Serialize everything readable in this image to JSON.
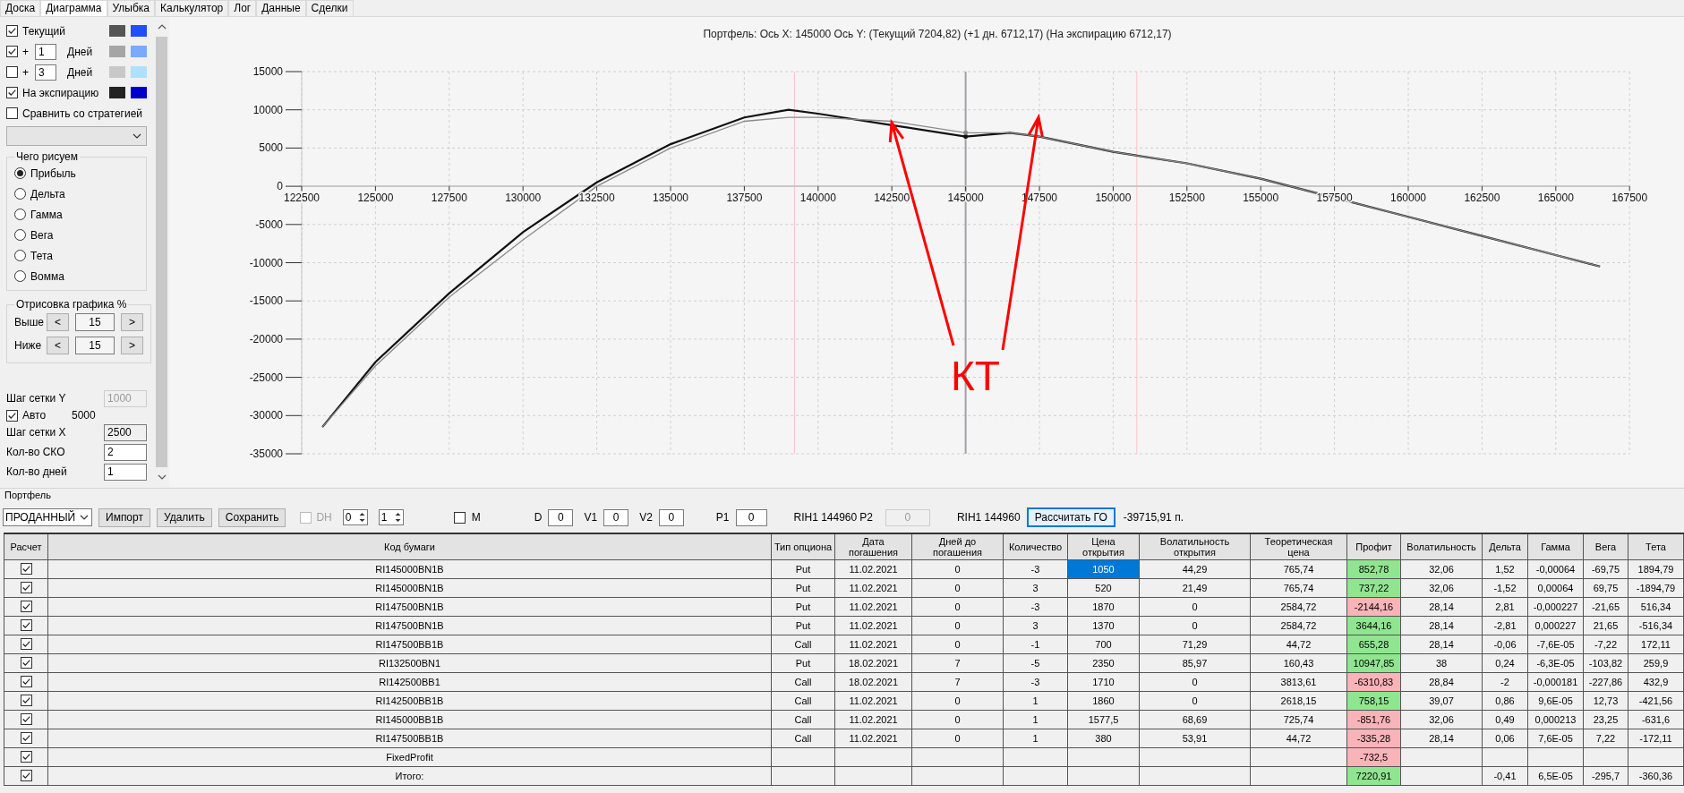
{
  "tabs": [
    {
      "label": "Доска",
      "selected": false
    },
    {
      "label": "Диаграмма",
      "selected": true
    },
    {
      "label": "Улыбка",
      "selected": false
    },
    {
      "label": "Калькулятор",
      "selected": false
    },
    {
      "label": "Лог",
      "selected": false
    },
    {
      "label": "Данные",
      "selected": false
    },
    {
      "label": "Сделки",
      "selected": false
    }
  ],
  "sidebar": {
    "series": [
      {
        "kind": "plain",
        "label": "Текущий",
        "checked": true,
        "swatches": [
          {
            "color": "#555555"
          },
          {
            "color": "#1f4fff"
          }
        ]
      },
      {
        "kind": "days",
        "checked": true,
        "plus": "+",
        "days": "1",
        "unit": "Дней",
        "swatches": [
          {
            "color": "#a5a5a5"
          },
          {
            "color": "#7aa9ff"
          }
        ]
      },
      {
        "kind": "days",
        "checked": false,
        "plus": "+",
        "days": "3",
        "unit": "Дней",
        "swatches": [
          {
            "color": "#c8c8c8"
          },
          {
            "color": "#aee0ff"
          }
        ]
      },
      {
        "kind": "plain",
        "label": "На экспирацию",
        "checked": true,
        "swatches": [
          {
            "color": "#222222"
          },
          {
            "color": "#0000cc"
          }
        ]
      }
    ],
    "compare": {
      "label": "Сравнить со стратегией",
      "checked": false
    },
    "draw_group": {
      "title": "Чего рисуем",
      "options": [
        {
          "label": "Прибыль",
          "selected": true
        },
        {
          "label": "Дельта",
          "selected": false
        },
        {
          "label": "Гамма",
          "selected": false
        },
        {
          "label": "Вега",
          "selected": false
        },
        {
          "label": "Тета",
          "selected": false
        },
        {
          "label": "Вомма",
          "selected": false
        }
      ]
    },
    "range_group": {
      "title": "Отрисовка графика %",
      "rows": [
        {
          "label": "Выше",
          "dec": "<",
          "value": "15",
          "inc": ">"
        },
        {
          "label": "Ниже",
          "dec": "<",
          "value": "15",
          "inc": ">"
        }
      ]
    },
    "grid": [
      {
        "kind": "field",
        "label": "Шаг сетки Y",
        "value": "1000",
        "disabled": true,
        "readonly": false
      },
      {
        "kind": "auto",
        "label": "Авто",
        "checked": true,
        "value": "5000"
      },
      {
        "kind": "field",
        "label": "Шаг сетки X",
        "value": "2500",
        "disabled": false,
        "readonly": true
      },
      {
        "kind": "field",
        "label": "Кол-во СКО",
        "value": "2",
        "disabled": false,
        "readonly": false
      },
      {
        "kind": "field",
        "label": "Кол-во дней",
        "value": "1",
        "disabled": false,
        "readonly": false
      }
    ]
  },
  "chart": {
    "title": "Портфель: Ось X: 145000 Ось Y:  (Текущий 7204,82)  (+1 дн. 6712,17)  (На экспирацию 6712,17)",
    "chart_data": {
      "type": "line",
      "x": [
        123200,
        125000,
        127500,
        130000,
        132500,
        135000,
        137500,
        139000,
        140000,
        142500,
        145000,
        146500,
        147500,
        150000,
        152500,
        155000,
        157500,
        160000,
        162500,
        165000,
        166500
      ],
      "series": [
        {
          "color": "#111111",
          "values": [
            -31500,
            -23000,
            -14000,
            -6000,
            500,
            5500,
            9000,
            10000,
            9500,
            8000,
            6500,
            7000,
            6500,
            4500,
            3000,
            1000,
            -1500,
            -4000,
            -6500,
            -9000,
            -10500
          ]
        },
        {
          "color": "#8a8a8a",
          "values": [
            -31500,
            -23500,
            -14500,
            -7000,
            0,
            5000,
            8500,
            9000,
            9000,
            8500,
            7000,
            7000,
            6500,
            4500,
            3000,
            1000,
            -1500,
            -4000,
            -6500,
            -9000,
            -10500
          ]
        }
      ],
      "xlim": [
        122500,
        167500
      ],
      "ylim": [
        -35000,
        15000
      ],
      "xticks": [
        122500,
        125000,
        127500,
        130000,
        132500,
        135000,
        137500,
        140000,
        142500,
        145000,
        147500,
        150000,
        152500,
        155000,
        157500,
        160000,
        162500,
        165000,
        167500
      ],
      "yticks": [
        -35000,
        -30000,
        -25000,
        -20000,
        -15000,
        -10000,
        -5000,
        0,
        5000,
        10000,
        15000
      ],
      "grid": true,
      "ref_lines": [
        {
          "axis": "x",
          "value": 139200,
          "color": "#ffc0c8"
        },
        {
          "axis": "x",
          "value": 150800,
          "color": "#ffc0c8"
        },
        {
          "axis": "x",
          "value": 145000,
          "color": "#a0a0a8"
        }
      ],
      "annotations": [
        "КТ"
      ]
    }
  },
  "portfolio": {
    "title": "Портфель",
    "filter": "ПРОДАННЫЙ",
    "buttons": [
      "Импорт",
      "Удалить",
      "Сохранить"
    ],
    "dh": {
      "label": "DH",
      "checked": false,
      "disabled": true
    },
    "spinners": [
      "0",
      "1"
    ],
    "m": {
      "label": "M",
      "checked": false
    },
    "fields": [
      {
        "label": "D",
        "value": "0",
        "disabled": false
      },
      {
        "label": "V1",
        "value": "0",
        "disabled": false
      },
      {
        "label": "V2",
        "value": "0",
        "disabled": false
      },
      {
        "label": "P1",
        "value": "0",
        "disabled": false,
        "note": "RIH1 144960"
      },
      {
        "label": "P2",
        "value": "0",
        "disabled": true,
        "note": "RIH1 144960"
      }
    ],
    "calc_button": "Рассчитать ГО",
    "margin": "-39715,91 п."
  },
  "table": {
    "columns": [
      "Расчет",
      "Код бумаги",
      "Тип опциона",
      "Дата погашения",
      "Дней до погашения",
      "Количество",
      "Цена открытия",
      "Волатильность открытия",
      "Теоретическая цена",
      "Профит",
      "Волатильность",
      "Дельта",
      "Гамма",
      "Вега",
      "Тета"
    ],
    "rows": [
      {
        "checked": true,
        "price_selected": true,
        "color": "#90e690",
        "cells": [
          "",
          "RI145000BN1B",
          "Put",
          "11.02.2021",
          "0",
          "-3",
          "1050",
          "44,29",
          "765,74",
          "852,78",
          "32,06",
          "1,52",
          "-0,00064",
          "-69,75",
          "1894,79"
        ]
      },
      {
        "checked": true,
        "price_selected": false,
        "color": "#90e690",
        "cells": [
          "",
          "RI145000BN1B",
          "Put",
          "11.02.2021",
          "0",
          "3",
          "520",
          "21,49",
          "765,74",
          "737,22",
          "32,06",
          "-1,52",
          "0,00064",
          "69,75",
          "-1894,79"
        ]
      },
      {
        "checked": true,
        "price_selected": false,
        "color": "#f8b4b8",
        "cells": [
          "",
          "RI147500BN1B",
          "Put",
          "11.02.2021",
          "0",
          "-3",
          "1870",
          "0",
          "2584,72",
          "-2144,16",
          "28,14",
          "2,81",
          "-0,000227",
          "-21,65",
          "516,34"
        ]
      },
      {
        "checked": true,
        "price_selected": false,
        "color": "#90e690",
        "cells": [
          "",
          "RI147500BN1B",
          "Put",
          "11.02.2021",
          "0",
          "3",
          "1370",
          "0",
          "2584,72",
          "3644,16",
          "28,14",
          "-2,81",
          "0,000227",
          "21,65",
          "-516,34"
        ]
      },
      {
        "checked": true,
        "price_selected": false,
        "color": "#90e690",
        "cells": [
          "",
          "RI147500BB1B",
          "Call",
          "11.02.2021",
          "0",
          "-1",
          "700",
          "71,29",
          "44,72",
          "655,28",
          "28,14",
          "-0,06",
          "-7,6E-05",
          "-7,22",
          "172,11"
        ]
      },
      {
        "checked": true,
        "price_selected": false,
        "color": "#90e690",
        "cells": [
          "",
          "RI132500BN1",
          "Put",
          "18.02.2021",
          "7",
          "-5",
          "2350",
          "85,97",
          "160,43",
          "10947,85",
          "38",
          "0,24",
          "-6,3E-05",
          "-103,82",
          "259,9"
        ]
      },
      {
        "checked": true,
        "price_selected": false,
        "color": "#f8b4b8",
        "cells": [
          "",
          "RI142500BB1",
          "Call",
          "18.02.2021",
          "7",
          "-3",
          "1710",
          "0",
          "3813,61",
          "-6310,83",
          "28,84",
          "-2",
          "-0,000181",
          "-227,86",
          "432,9"
        ]
      },
      {
        "checked": true,
        "price_selected": false,
        "color": "#90e690",
        "cells": [
          "",
          "RI142500BB1B",
          "Call",
          "11.02.2021",
          "0",
          "1",
          "1860",
          "0",
          "2618,15",
          "758,15",
          "39,07",
          "0,86",
          "9,6E-05",
          "12,73",
          "-421,56"
        ]
      },
      {
        "checked": true,
        "price_selected": false,
        "color": "#f8b4b8",
        "cells": [
          "",
          "RI145000BB1B",
          "Call",
          "11.02.2021",
          "0",
          "1",
          "1577,5",
          "68,69",
          "725,74",
          "-851,76",
          "32,06",
          "0,49",
          "0,000213",
          "23,25",
          "-631,6"
        ]
      },
      {
        "checked": true,
        "price_selected": false,
        "color": "#f8b4b8",
        "cells": [
          "",
          "RI147500BB1B",
          "Call",
          "11.02.2021",
          "0",
          "1",
          "380",
          "53,91",
          "44,72",
          "-335,28",
          "28,14",
          "0,06",
          "7,6E-05",
          "7,22",
          "-172,11"
        ]
      },
      {
        "checked": true,
        "price_selected": false,
        "color": "#f8b4b8",
        "cells": [
          "",
          "FixedProfit",
          null,
          null,
          null,
          null,
          null,
          null,
          null,
          "-732,5",
          null,
          null,
          null,
          null,
          null
        ]
      },
      {
        "checked": true,
        "price_selected": false,
        "color": "#90e690",
        "cells": [
          "",
          "Итого:",
          null,
          null,
          null,
          null,
          null,
          null,
          null,
          "7220,91",
          null,
          "-0,41",
          "6,5E-05",
          "-295,7",
          "-360,36"
        ]
      }
    ]
  }
}
